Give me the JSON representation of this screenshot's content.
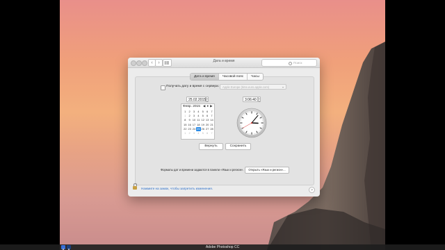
{
  "window": {
    "title": "Дата и время",
    "search_placeholder": "Поиск"
  },
  "tabs": [
    {
      "label": "Дата и время",
      "active": true
    },
    {
      "label": "Часовой пояс",
      "active": false
    },
    {
      "label": "Часы",
      "active": false
    }
  ],
  "server": {
    "checkbox_label": "Получать дату и время с сервера:",
    "checked": false,
    "server_value": "Apple Europe (time.euro.apple.com)"
  },
  "date_field": "25.02.2015",
  "time_field": "3:06:40",
  "calendar": {
    "header": "Февр. 2015",
    "nav": "◀ ● ▶",
    "days": [
      {
        "d": "1",
        "dim": false
      },
      {
        "d": "2",
        "dim": false
      },
      {
        "d": "3",
        "dim": false
      },
      {
        "d": "4",
        "dim": false
      },
      {
        "d": "5",
        "dim": false
      },
      {
        "d": "6",
        "dim": false
      },
      {
        "d": "7",
        "dim": false
      },
      {
        "d": "1",
        "dim": true
      },
      {
        "d": "2",
        "dim": false
      },
      {
        "d": "3",
        "dim": false
      },
      {
        "d": "4",
        "dim": false
      },
      {
        "d": "5",
        "dim": false
      },
      {
        "d": "6",
        "dim": false
      },
      {
        "d": "7",
        "dim": false
      },
      {
        "d": "8",
        "dim": false
      },
      {
        "d": "9",
        "dim": false
      },
      {
        "d": "10",
        "dim": false
      },
      {
        "d": "11",
        "dim": false
      },
      {
        "d": "12",
        "dim": false
      },
      {
        "d": "13",
        "dim": false
      },
      {
        "d": "14",
        "dim": false
      },
      {
        "d": "15",
        "dim": false
      },
      {
        "d": "16",
        "dim": false
      },
      {
        "d": "17",
        "dim": false
      },
      {
        "d": "18",
        "dim": false
      },
      {
        "d": "19",
        "dim": false
      },
      {
        "d": "20",
        "dim": false
      },
      {
        "d": "21",
        "dim": false
      },
      {
        "d": "22",
        "dim": false
      },
      {
        "d": "23",
        "dim": false
      },
      {
        "d": "24",
        "dim": false
      },
      {
        "d": "25",
        "dim": false,
        "sel": true
      },
      {
        "d": "26",
        "dim": false
      },
      {
        "d": "27",
        "dim": false
      },
      {
        "d": "28",
        "dim": false
      },
      {
        "d": "1",
        "dim": true
      },
      {
        "d": "2",
        "dim": true
      },
      {
        "d": "3",
        "dim": true
      },
      {
        "d": "4",
        "dim": true
      },
      {
        "d": "5",
        "dim": true
      },
      {
        "d": "6",
        "dim": true
      },
      {
        "d": "7",
        "dim": true
      }
    ]
  },
  "clock": {
    "hours": 3,
    "minutes": 6,
    "seconds": 40
  },
  "buttons": {
    "revert": "Вернуть",
    "save": "Сохранить",
    "open_lang_region": "Открыть «Язык и регион»..."
  },
  "formats_note": "Форматы дат и времени задаются в панели «Язык и регион».",
  "lock_text": "Нажмите на замок, чтобы запретить изменения.",
  "help": "?",
  "dock_label": "Adobe Photoshop CC",
  "colors": {
    "accent": "#2a8be6",
    "lock_link": "#2a6ec9"
  }
}
